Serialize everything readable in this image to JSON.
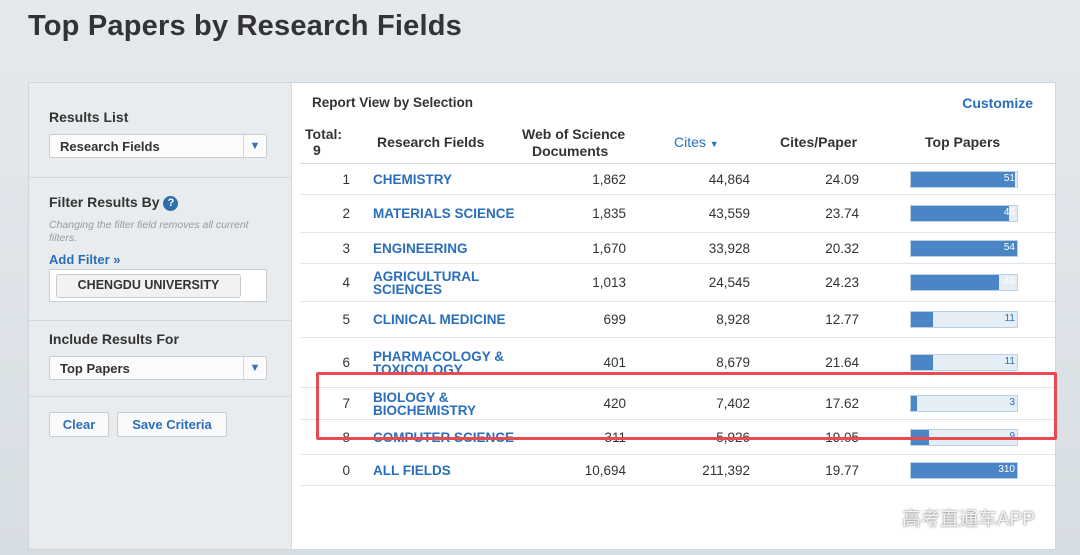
{
  "page_title": "Top Papers by Research Fields",
  "sidebar": {
    "results_list_label": "Results List",
    "results_list_value": "Research Fields",
    "filter_label": "Filter Results By",
    "filter_hint": "Changing the filter field removes all current filters.",
    "add_filter": "Add Filter »",
    "filter_chip": "CHENGDU UNIVERSITY",
    "include_label": "Include Results For",
    "include_value": "Top Papers",
    "clear": "Clear",
    "save_criteria": "Save Criteria"
  },
  "main": {
    "report_view": "Report View by Selection",
    "customize": "Customize",
    "headers": {
      "total": "Total:",
      "total_count": "9",
      "field": "Research Fields",
      "docs_line1": "Web of Science",
      "docs_line2": "Documents",
      "cites": "Cites",
      "cites_paper": "Cites/Paper",
      "top_papers": "Top Papers"
    },
    "rows": [
      {
        "rank": "1",
        "field": "CHEMISTRY",
        "docs": "1,862",
        "cites": "44,864",
        "cpp": "24.09",
        "top": "51",
        "fill": 0.98
      },
      {
        "rank": "2",
        "field": "MATERIALS SCIENCE",
        "docs": "1,835",
        "cites": "43,559",
        "cpp": "23.74",
        "top": "48",
        "fill": 0.92
      },
      {
        "rank": "3",
        "field": "ENGINEERING",
        "docs": "1,670",
        "cites": "33,928",
        "cpp": "20.32",
        "top": "54",
        "fill": 1.0
      },
      {
        "rank": "4",
        "field": "AGRICULTURAL SCIENCES",
        "docs": "1,013",
        "cites": "24,545",
        "cpp": "24.23",
        "top": "45",
        "fill": 0.83
      },
      {
        "rank": "5",
        "field": "CLINICAL MEDICINE",
        "docs": "699",
        "cites": "8,928",
        "cpp": "12.77",
        "top": "11",
        "fill": 0.21
      },
      {
        "rank": "6",
        "field": "PHARMACOLOGY & TOXICOLOGY",
        "docs": "401",
        "cites": "8,679",
        "cpp": "21.64",
        "top": "11",
        "fill": 0.21
      },
      {
        "rank": "7",
        "field": "BIOLOGY & BIOCHEMISTRY",
        "docs": "420",
        "cites": "7,402",
        "cpp": "17.62",
        "top": "3",
        "fill": 0.06
      },
      {
        "rank": "8",
        "field": "COMPUTER SCIENCE",
        "docs": "311",
        "cites": "5,926",
        "cpp": "19.05",
        "top": "9",
        "fill": 0.17
      },
      {
        "rank": "0",
        "field": "ALL FIELDS",
        "docs": "10,694",
        "cites": "211,392",
        "cpp": "19.77",
        "top": "310",
        "fill": 1.0
      }
    ]
  },
  "watermark": "高考直通车APP"
}
